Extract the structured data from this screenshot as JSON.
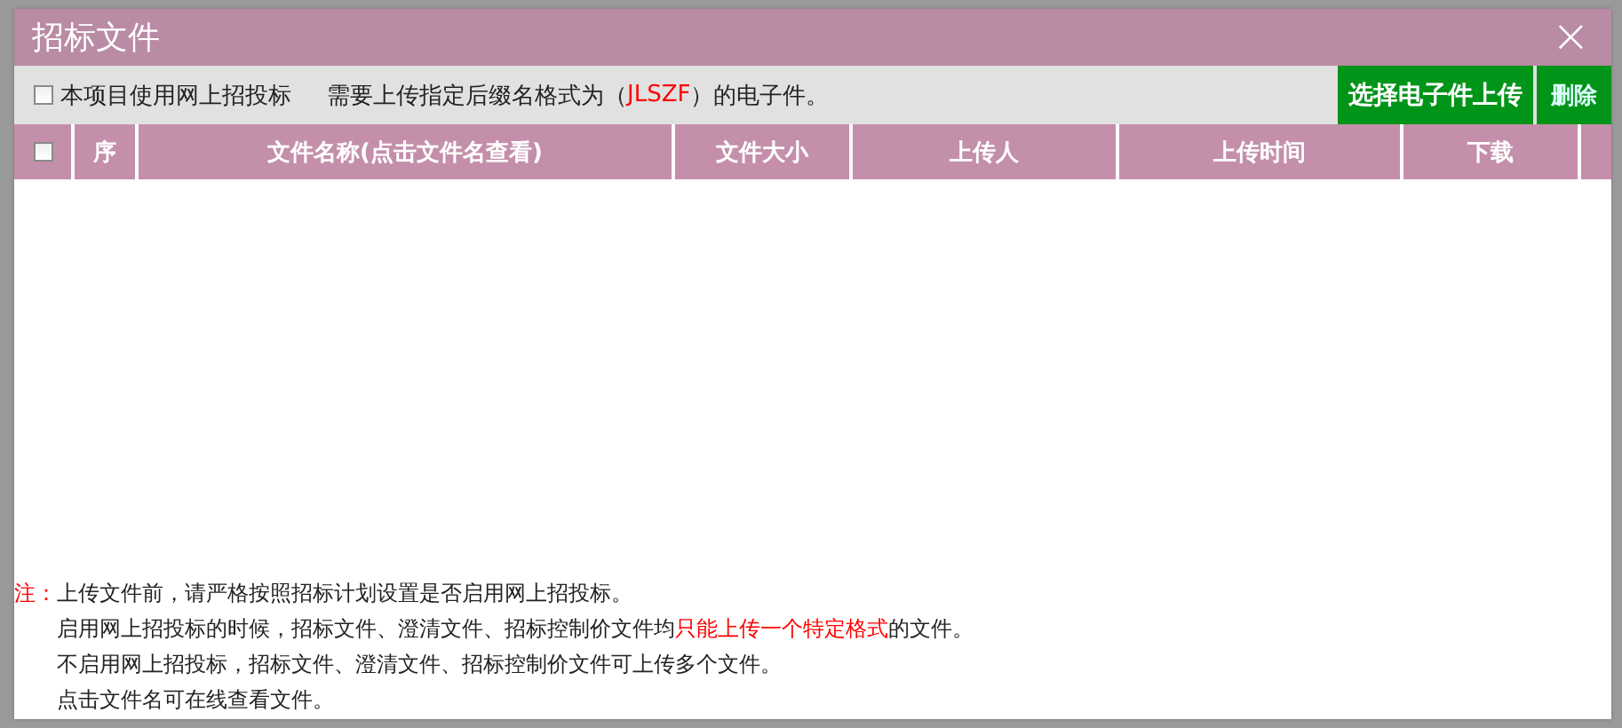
{
  "dialog": {
    "title": "招标文件",
    "close_icon": "×"
  },
  "toolbar": {
    "online_option": {
      "label": "本项目使用网上招投标",
      "checked": false
    },
    "hint": [
      {
        "text": "需要上传指定后缀名格式为（ ",
        "emphasis": false
      },
      {
        "text": "JLSZF",
        "emphasis": true
      },
      {
        "text": " ）的电子件。",
        "emphasis": false
      }
    ],
    "buttons": [
      "选择电子件上传",
      "删除"
    ]
  },
  "table": {
    "select_all": {
      "checked": false
    },
    "columns": [
      "序",
      "文件名称(点击文件名查看)",
      "文件大小",
      "上传人",
      "上传时间",
      "下载"
    ]
  },
  "notes": [
    [
      {
        "text": "注：",
        "emphasis": true
      },
      {
        "text": "上传文件前，请严格按照招标计划设置是否启用网上招投标。",
        "emphasis": false
      }
    ],
    [
      {
        "text": "启用网上招投标的时候，招标文件、澄清文件、招标控制价文件均",
        "emphasis": false
      },
      {
        "text": "只能上传一个特定格式",
        "emphasis": true
      },
      {
        "text": "的文件。",
        "emphasis": false
      }
    ],
    [
      {
        "text": "不启用网上招投标，招标文件、澄清文件、招标控制价文件可上传多个文件。",
        "emphasis": false
      }
    ],
    [
      {
        "text": "点击文件名可在线查看文件。",
        "emphasis": false
      }
    ]
  ]
}
